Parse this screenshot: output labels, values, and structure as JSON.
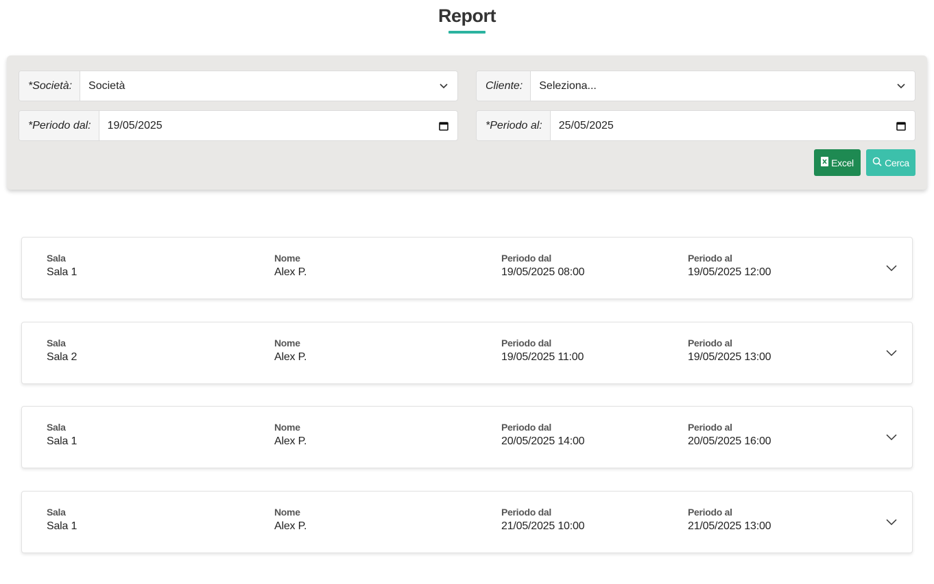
{
  "page": {
    "title": "Report"
  },
  "filters": {
    "societa": {
      "label": "*Società:",
      "value": "Società"
    },
    "cliente": {
      "label": "Cliente:",
      "value": "Seleziona..."
    },
    "periodo_dal": {
      "label": "*Periodo dal:",
      "value": "19/05/2025"
    },
    "periodo_al": {
      "label": "*Periodo al:",
      "value": "25/05/2025"
    }
  },
  "buttons": {
    "excel": {
      "label": "Excel",
      "color": "#1e8a52",
      "icon": "excel-file-icon"
    },
    "cerca": {
      "label": "Cerca",
      "color": "#3cc0ab",
      "icon": "search-icon"
    }
  },
  "columns": {
    "sala": "Sala",
    "nome": "Nome",
    "periodo_dal": "Periodo dal",
    "periodo_al": "Periodo al"
  },
  "records": [
    {
      "sala": "Sala 1",
      "nome": "Alex P.",
      "periodo_dal": "19/05/2025 08:00",
      "periodo_al": "19/05/2025 12:00"
    },
    {
      "sala": "Sala 2",
      "nome": "Alex P.",
      "periodo_dal": "19/05/2025 11:00",
      "periodo_al": "19/05/2025 13:00"
    },
    {
      "sala": "Sala 1",
      "nome": "Alex P.",
      "periodo_dal": "20/05/2025 14:00",
      "periodo_al": "20/05/2025 16:00"
    },
    {
      "sala": "Sala 1",
      "nome": "Alex P.",
      "periodo_dal": "21/05/2025 10:00",
      "periodo_al": "21/05/2025 13:00"
    }
  ],
  "colors": {
    "accent": "#2bb3a0",
    "panel": "#e9e8e6"
  }
}
